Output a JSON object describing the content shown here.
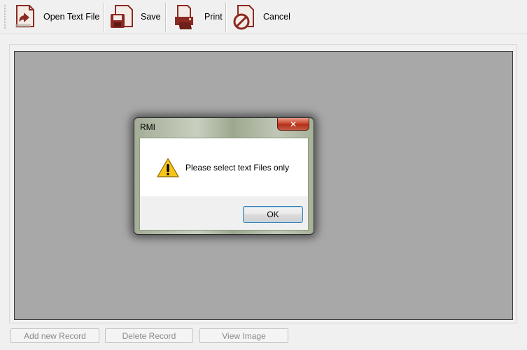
{
  "toolbar": {
    "buttons": [
      {
        "label": "Open Text File",
        "icon": "open-text-file-icon"
      },
      {
        "label": "Save",
        "icon": "save-icon"
      },
      {
        "label": "Print",
        "icon": "print-icon"
      },
      {
        "label": "Cancel",
        "icon": "cancel-icon"
      }
    ]
  },
  "bottom_buttons": {
    "add_new_record": "Add new Record",
    "delete_record": "Delete Record",
    "view_image": "View Image"
  },
  "dialog": {
    "title": "RMI",
    "close_glyph": "✕",
    "message": "Please select text Files only",
    "ok_label": "OK",
    "icon": "warning-icon"
  },
  "colors": {
    "toolbar_icon": "#8b2a22",
    "canvas_bg": "#a8a8a8",
    "warning_yellow": "#f6c51c",
    "close_red": "#c9482f"
  }
}
